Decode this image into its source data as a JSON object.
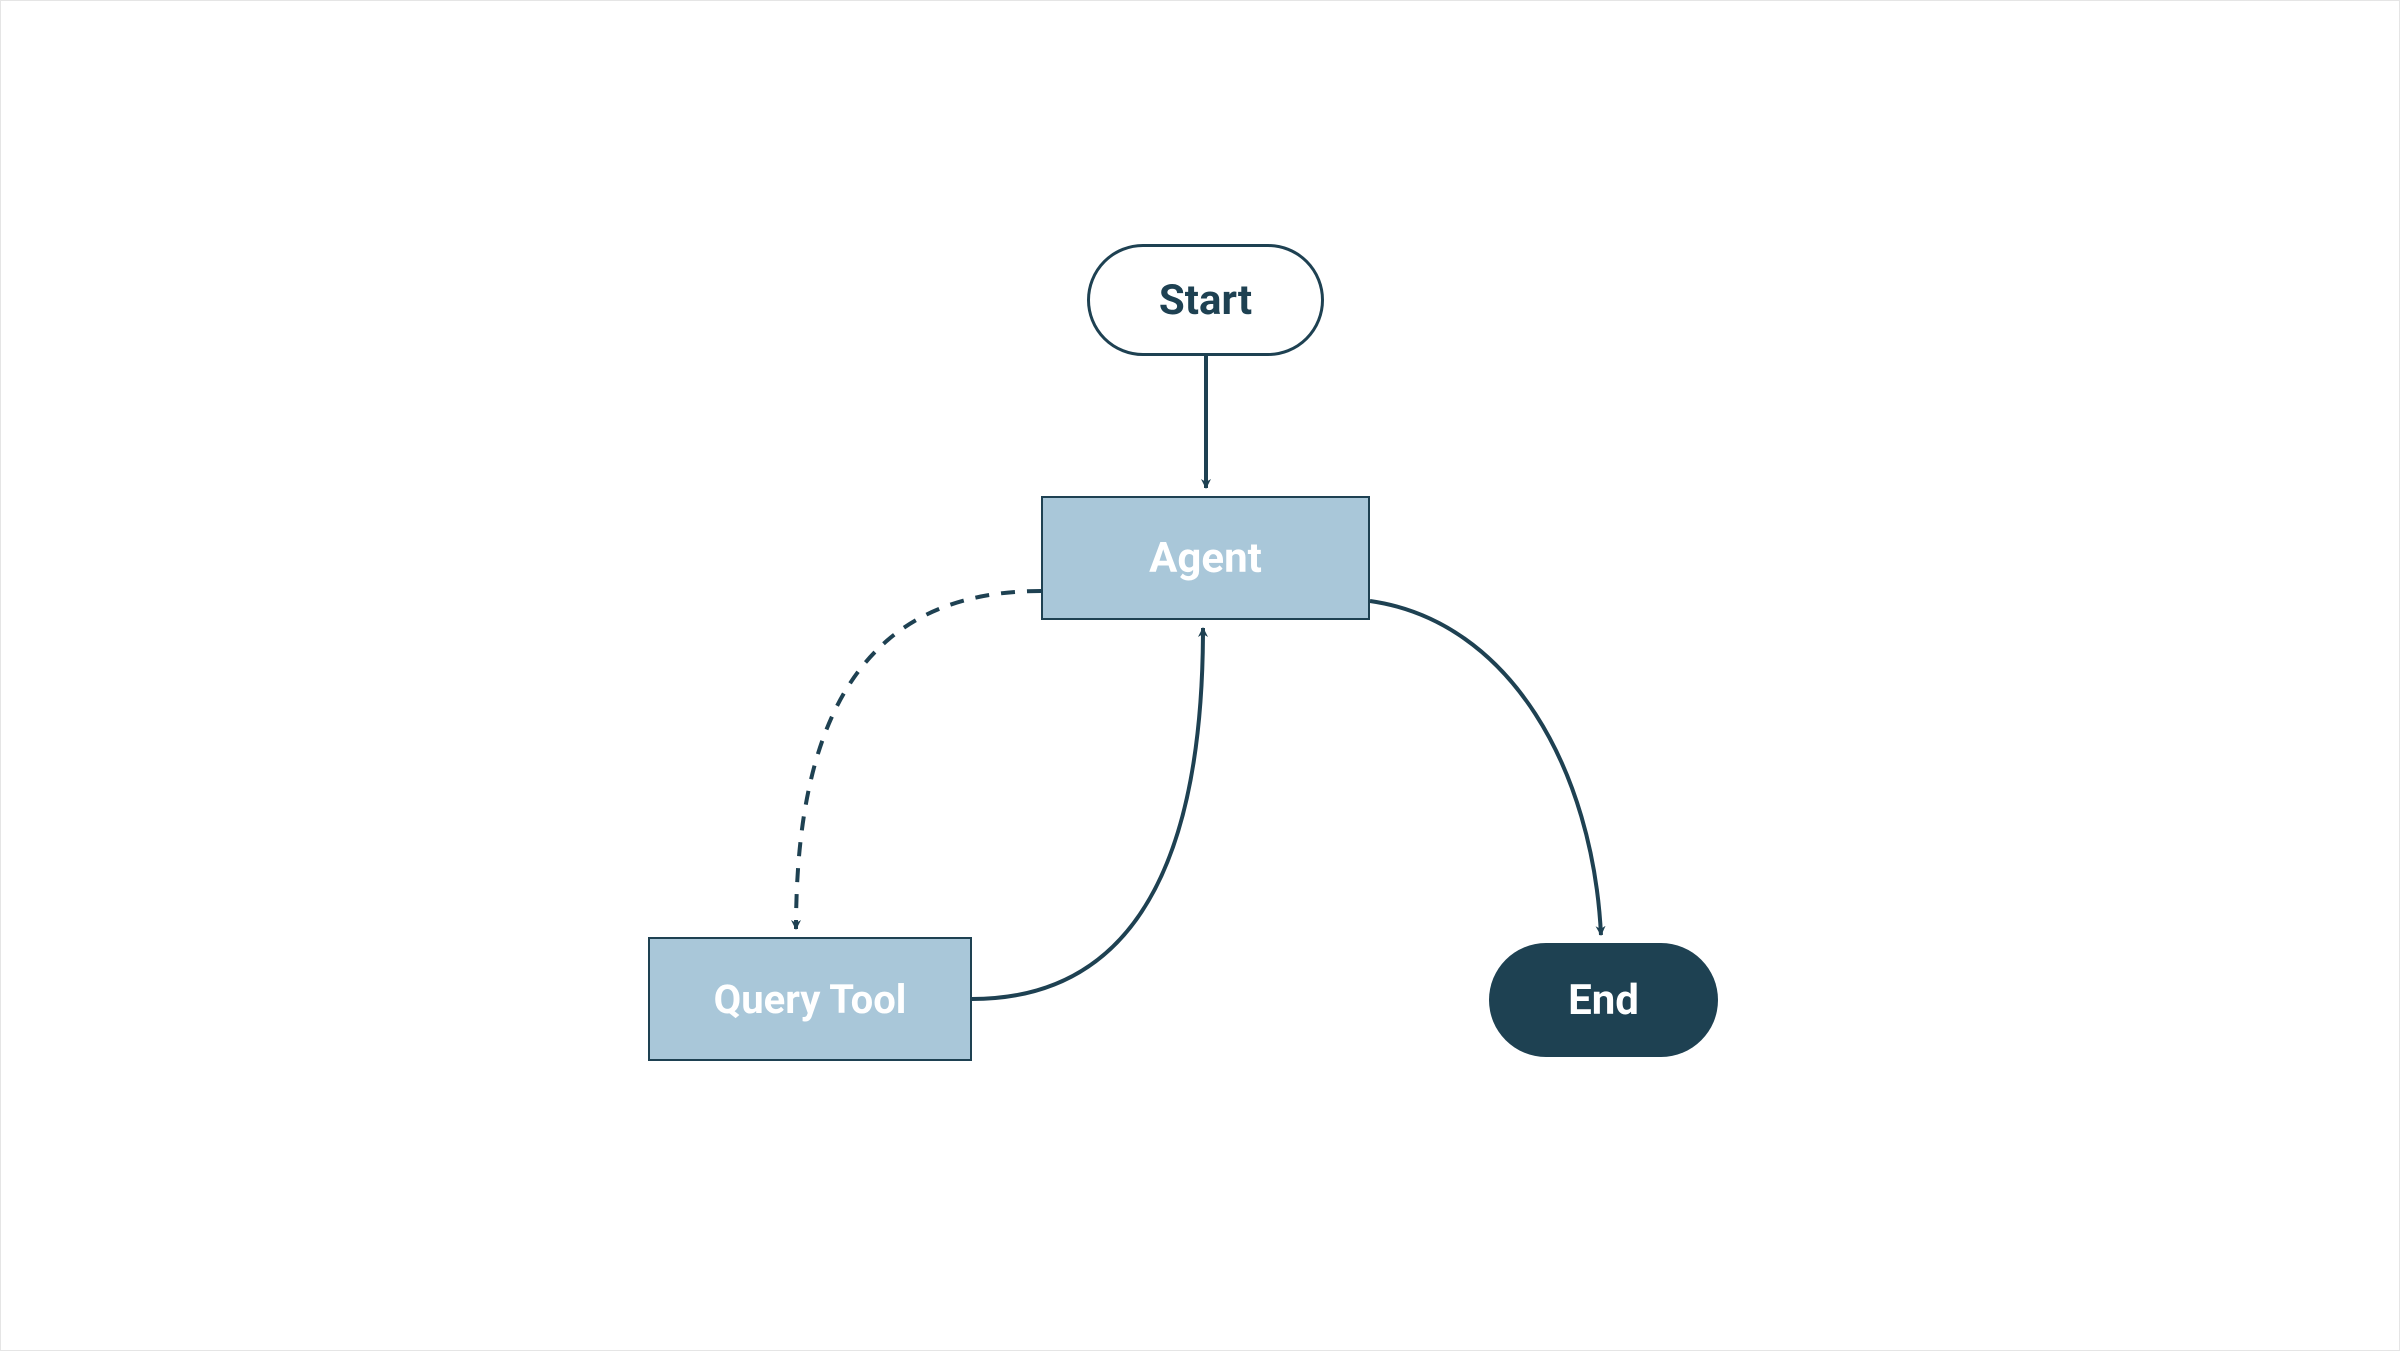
{
  "diagram": {
    "nodes": {
      "start": {
        "label": "Start",
        "type": "terminal",
        "fill": "#ffffff",
        "color": "#1e4152"
      },
      "agent": {
        "label": "Agent",
        "type": "process",
        "fill": "#a9c7d9",
        "color": "#ffffff"
      },
      "query_tool": {
        "label": "Query Tool",
        "type": "process",
        "fill": "#a9c7d9",
        "color": "#ffffff"
      },
      "end": {
        "label": "End",
        "type": "terminal",
        "fill": "#1e4152",
        "color": "#ffffff"
      }
    },
    "edges": [
      {
        "from": "start",
        "to": "agent",
        "style": "solid"
      },
      {
        "from": "agent",
        "to": "query_tool",
        "style": "dashed"
      },
      {
        "from": "query_tool",
        "to": "agent",
        "style": "solid"
      },
      {
        "from": "agent",
        "to": "end",
        "style": "solid"
      }
    ],
    "colors": {
      "stroke": "#1e4152",
      "light_fill": "#a9c7d9",
      "dark_fill": "#1e4152"
    }
  }
}
